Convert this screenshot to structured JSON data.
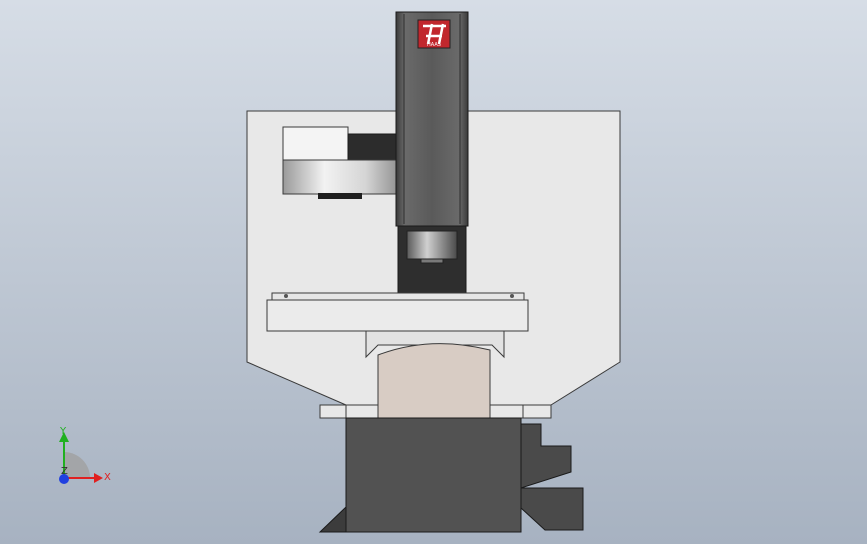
{
  "viewport": {
    "background_top": "#d6dde6",
    "background_bottom": "#a7b2c1"
  },
  "model": {
    "enclosure_color": "#e8e8e8",
    "column_color": "#555555",
    "base_color": "#525252",
    "saddle_color": "#d8ccc4",
    "logo_color": "#c1272d",
    "logo_text": "HAAS"
  },
  "triad": {
    "x_label": "X",
    "y_label": "Y",
    "z_label": "Z",
    "x_color": "#e02020",
    "y_color": "#20b020",
    "z_color": "#2040e0"
  }
}
